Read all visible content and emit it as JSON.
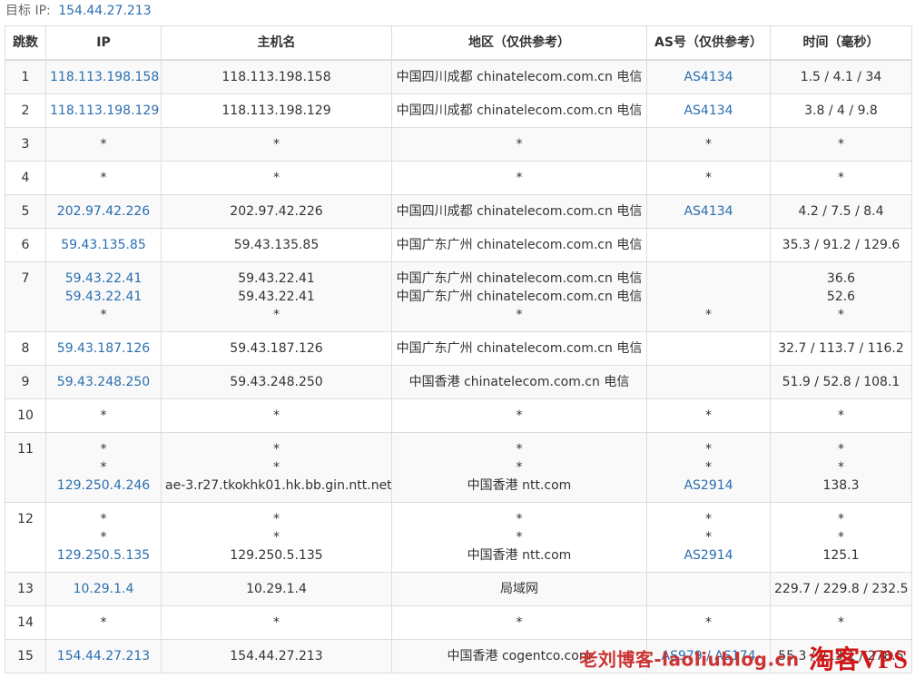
{
  "target": {
    "label": "目标 IP:",
    "ip": "154.44.27.213"
  },
  "columns": [
    "跳数",
    "IP",
    "主机名",
    "地区（仅供参考）",
    "AS号（仅供参考）",
    "时间（毫秒）"
  ],
  "rows": [
    {
      "hop": "1",
      "lines": [
        {
          "ip": "118.113.198.158",
          "host": "118.113.198.158",
          "region": "中国四川成都 chinatelecom.com.cn 电信",
          "as": "AS4134",
          "time": "1.5 / 4.1 / 34"
        }
      ]
    },
    {
      "hop": "2",
      "lines": [
        {
          "ip": "118.113.198.129",
          "host": "118.113.198.129",
          "region": "中国四川成都 chinatelecom.com.cn 电信",
          "as": "AS4134",
          "time": "3.8 / 4 / 9.8"
        }
      ]
    },
    {
      "hop": "3",
      "lines": [
        {
          "ip": "*",
          "host": "*",
          "region": "*",
          "as": "*",
          "time": "*"
        }
      ]
    },
    {
      "hop": "4",
      "lines": [
        {
          "ip": "*",
          "host": "*",
          "region": "*",
          "as": "*",
          "time": "*"
        }
      ]
    },
    {
      "hop": "5",
      "lines": [
        {
          "ip": "202.97.42.226",
          "host": "202.97.42.226",
          "region": "中国四川成都 chinatelecom.com.cn 电信",
          "as": "AS4134",
          "time": "4.2 / 7.5 / 8.4"
        }
      ]
    },
    {
      "hop": "6",
      "lines": [
        {
          "ip": "59.43.135.85",
          "host": "59.43.135.85",
          "region": "中国广东广州 chinatelecom.com.cn 电信",
          "as": "",
          "time": "35.3 / 91.2 / 129.6"
        }
      ]
    },
    {
      "hop": "7",
      "lines": [
        {
          "ip": "59.43.22.41",
          "host": "59.43.22.41",
          "region": "中国广东广州 chinatelecom.com.cn 电信",
          "as": "",
          "time": "36.6"
        },
        {
          "ip": "59.43.22.41",
          "host": "59.43.22.41",
          "region": "中国广东广州 chinatelecom.com.cn 电信",
          "as": "",
          "time": "52.6"
        },
        {
          "ip": "*",
          "host": "*",
          "region": "*",
          "as": "*",
          "time": "*"
        }
      ]
    },
    {
      "hop": "8",
      "lines": [
        {
          "ip": "59.43.187.126",
          "host": "59.43.187.126",
          "region": "中国广东广州 chinatelecom.com.cn 电信",
          "as": "",
          "time": "32.7 / 113.7 / 116.2"
        }
      ]
    },
    {
      "hop": "9",
      "lines": [
        {
          "ip": "59.43.248.250",
          "host": "59.43.248.250",
          "region": "中国香港 chinatelecom.com.cn 电信",
          "as": "",
          "time": "51.9 / 52.8 / 108.1"
        }
      ]
    },
    {
      "hop": "10",
      "lines": [
        {
          "ip": "*",
          "host": "*",
          "region": "*",
          "as": "*",
          "time": "*"
        }
      ]
    },
    {
      "hop": "11",
      "lines": [
        {
          "ip": "*",
          "host": "*",
          "region": "*",
          "as": "*",
          "time": "*"
        },
        {
          "ip": "*",
          "host": "*",
          "region": "*",
          "as": "*",
          "time": "*"
        },
        {
          "ip": "129.250.4.246",
          "host": "ae-3.r27.tkokhk01.hk.bb.gin.ntt.net",
          "region": "中国香港 ntt.com",
          "as": "AS2914",
          "time": "138.3"
        }
      ]
    },
    {
      "hop": "12",
      "lines": [
        {
          "ip": "*",
          "host": "*",
          "region": "*",
          "as": "*",
          "time": "*"
        },
        {
          "ip": "*",
          "host": "*",
          "region": "*",
          "as": "*",
          "time": "*"
        },
        {
          "ip": "129.250.5.135",
          "host": "129.250.5.135",
          "region": "中国香港 ntt.com",
          "as": "AS2914",
          "time": "125.1"
        }
      ]
    },
    {
      "hop": "13",
      "lines": [
        {
          "ip": "10.29.1.4",
          "host": "10.29.1.4",
          "region": "局域网",
          "as": "",
          "time": "229.7 / 229.8 / 232.5"
        }
      ]
    },
    {
      "hop": "14",
      "lines": [
        {
          "ip": "*",
          "host": "*",
          "region": "*",
          "as": "*",
          "time": "*"
        }
      ]
    },
    {
      "hop": "15",
      "lines": [
        {
          "ip": "154.44.27.213",
          "host": "154.44.27.213",
          "region": "中国香港 cogentco.com",
          "as": "AS979 / AS174",
          "time": "55.3 / 213.1 / 278.5"
        }
      ]
    }
  ],
  "watermark": {
    "blog": "老刘博客-laoliublog.cn",
    "vps": "淘客VPS"
  },
  "colors": {
    "link": "#2a6fb0",
    "border": "#dddddd",
    "stripe": "#f9f9f9",
    "watermark": "#d01818"
  }
}
